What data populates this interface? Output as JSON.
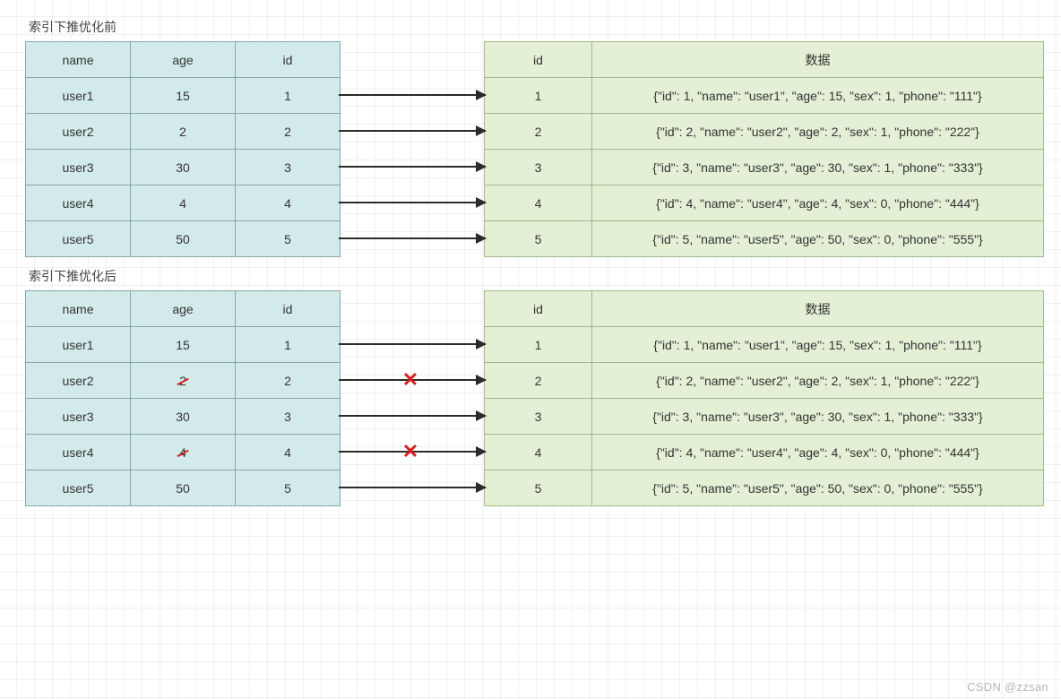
{
  "titles": {
    "before": "索引下推优化前",
    "after": "索引下推优化后"
  },
  "index_headers": {
    "name": "name",
    "age": "age",
    "id": "id"
  },
  "data_headers": {
    "id": "id",
    "data": "数据"
  },
  "before": {
    "index": [
      {
        "name": "user1",
        "age": "15",
        "id": "1"
      },
      {
        "name": "user2",
        "age": "2",
        "id": "2"
      },
      {
        "name": "user3",
        "age": "30",
        "id": "3"
      },
      {
        "name": "user4",
        "age": "4",
        "id": "4"
      },
      {
        "name": "user5",
        "age": "50",
        "id": "5"
      }
    ],
    "data": [
      {
        "id": "1",
        "data": "{\"id\": 1, \"name\": \"user1\", \"age\": 15, \"sex\": 1, \"phone\": \"111\"}"
      },
      {
        "id": "2",
        "data": "{\"id\": 2, \"name\": \"user2\", \"age\": 2, \"sex\": 1, \"phone\": \"222\"}"
      },
      {
        "id": "3",
        "data": "{\"id\": 3, \"name\": \"user3\", \"age\": 30, \"sex\": 1, \"phone\": \"333\"}"
      },
      {
        "id": "4",
        "data": "{\"id\": 4, \"name\": \"user4\", \"age\": 4, \"sex\": 0, \"phone\": \"444\"}"
      },
      {
        "id": "5",
        "data": "{\"id\": 5, \"name\": \"user5\", \"age\": 50, \"sex\": 0, \"phone\": \"555\"}"
      }
    ],
    "arrows": [
      {
        "blocked": false
      },
      {
        "blocked": false
      },
      {
        "blocked": false
      },
      {
        "blocked": false
      },
      {
        "blocked": false
      }
    ]
  },
  "after": {
    "index": [
      {
        "name": "user1",
        "age": "15",
        "id": "1",
        "age_strike": false
      },
      {
        "name": "user2",
        "age": "2",
        "id": "2",
        "age_strike": true
      },
      {
        "name": "user3",
        "age": "30",
        "id": "3",
        "age_strike": false
      },
      {
        "name": "user4",
        "age": "4",
        "id": "4",
        "age_strike": true
      },
      {
        "name": "user5",
        "age": "50",
        "id": "5",
        "age_strike": false
      }
    ],
    "data": [
      {
        "id": "1",
        "data": "{\"id\": 1, \"name\": \"user1\", \"age\": 15, \"sex\": 1, \"phone\": \"111\"}"
      },
      {
        "id": "2",
        "data": "{\"id\": 2, \"name\": \"user2\", \"age\": 2, \"sex\": 1, \"phone\": \"222\"}"
      },
      {
        "id": "3",
        "data": "{\"id\": 3, \"name\": \"user3\", \"age\": 30, \"sex\": 1, \"phone\": \"333\"}"
      },
      {
        "id": "4",
        "data": "{\"id\": 4, \"name\": \"user4\", \"age\": 4, \"sex\": 0, \"phone\": \"444\"}"
      },
      {
        "id": "5",
        "data": "{\"id\": 5, \"name\": \"user5\", \"age\": 50, \"sex\": 0, \"phone\": \"555\"}"
      }
    ],
    "arrows": [
      {
        "blocked": false
      },
      {
        "blocked": true
      },
      {
        "blocked": false
      },
      {
        "blocked": true
      },
      {
        "blocked": false
      }
    ]
  },
  "watermark": "CSDN @zzsan"
}
